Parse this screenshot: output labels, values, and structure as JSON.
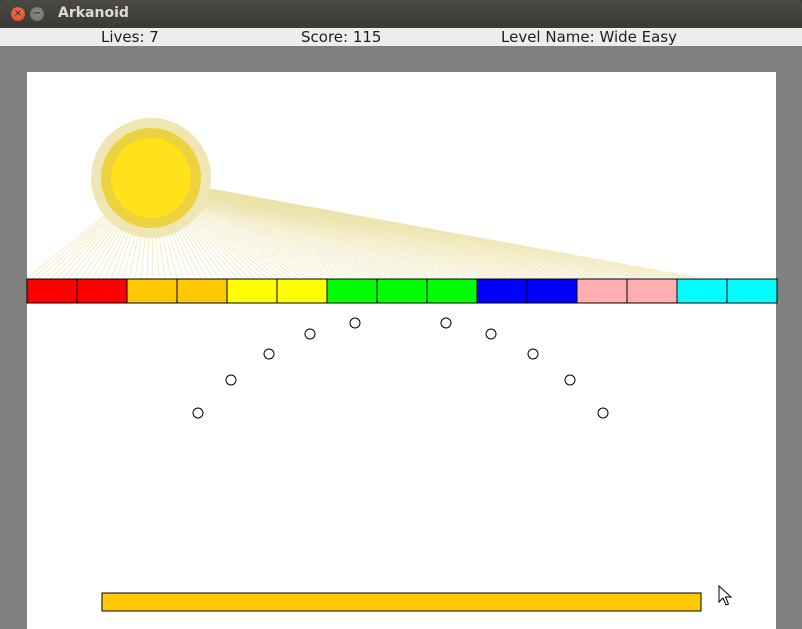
{
  "window": {
    "title": "Arkanoid",
    "close_glyph": "×",
    "minimize_glyph": "−"
  },
  "status": {
    "lives_label": "Lives: 7",
    "score_label": "Score: 115",
    "level_label": "Level Name: Wide Easy"
  },
  "game": {
    "border_color": "#808080",
    "field_color": "#ffffff",
    "sun": {
      "outer_color": "#efe6b4",
      "middle_color": "#ecd23e",
      "inner_color": "#ffe21a",
      "ray_color": "#ece2a8"
    },
    "block_colors": [
      "#ff0000",
      "#ff0000",
      "#ffc800",
      "#ffc800",
      "#ffff00",
      "#ffff00",
      "#00ff00",
      "#00ff00",
      "#00ff00",
      "#0000ff",
      "#0000ff",
      "#ffafaf",
      "#ffafaf",
      "#00ffff",
      "#00ffff"
    ],
    "ball_count": 10,
    "paddle_color": "#ffc800"
  },
  "cursor": {
    "icon": "mouse-pointer-icon"
  }
}
